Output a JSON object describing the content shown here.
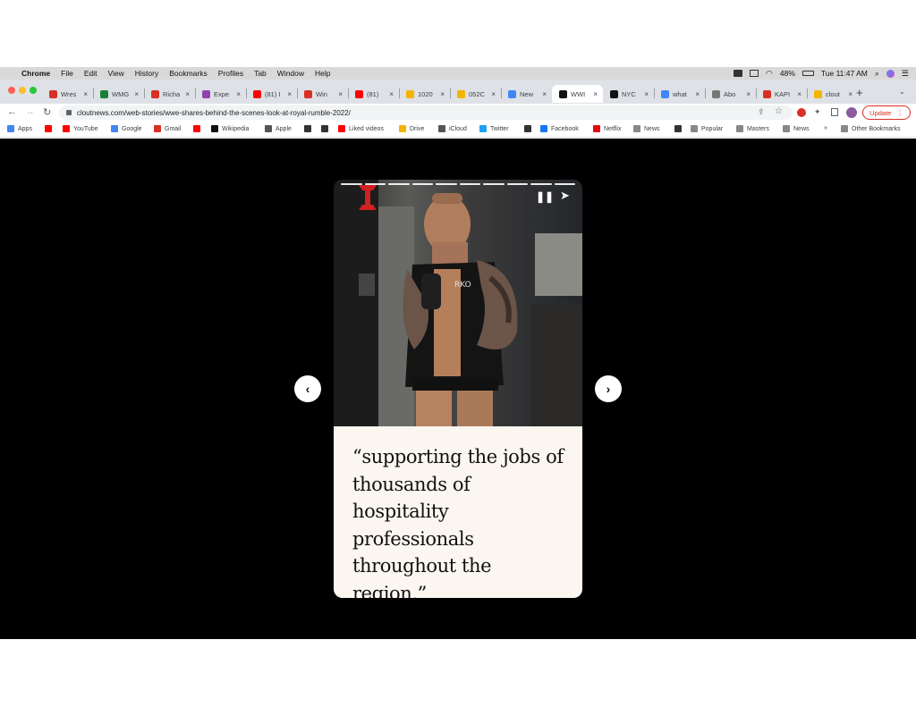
{
  "menubar": {
    "app": "Chrome",
    "items": [
      "File",
      "Edit",
      "View",
      "History",
      "Bookmarks",
      "Profiles",
      "Tab",
      "Window",
      "Help"
    ],
    "battery": "48%",
    "clock": "Tue 11:47 AM"
  },
  "tabs": [
    {
      "label": "Wres",
      "color": "#d93025"
    },
    {
      "label": "WMG",
      "color": "#188038"
    },
    {
      "label": "Richa",
      "color": "#d93025"
    },
    {
      "label": "Expe",
      "color": "#8e44ad"
    },
    {
      "label": "(81) I",
      "color": "#ff0000"
    },
    {
      "label": "Win",
      "color": "#d93025"
    },
    {
      "label": "(81)",
      "color": "#ff0000"
    },
    {
      "label": "1020",
      "color": "#f4b400"
    },
    {
      "label": "052C",
      "color": "#f4b400"
    },
    {
      "label": "New",
      "color": "#4285f4"
    },
    {
      "label": "WWI",
      "color": "#111111"
    },
    {
      "label": "NYC",
      "color": "#111111"
    },
    {
      "label": "what",
      "color": "#4285f4"
    },
    {
      "label": "Abo",
      "color": "#777777"
    },
    {
      "label": "KAPI",
      "color": "#d93025"
    },
    {
      "label": "clout",
      "color": "#f4b400"
    }
  ],
  "address": {
    "url": "cloutnews.com/web-stories/wwe-shares-behind-the-scenes-look-at-royal-rumble-2022/",
    "update_label": "Update"
  },
  "bookmarks": [
    {
      "label": "Apps",
      "color": "#4285f4"
    },
    {
      "label": "",
      "color": "#ff0000"
    },
    {
      "label": "YouTube",
      "color": "#ff0000"
    },
    {
      "label": "Google",
      "color": "#4285f4"
    },
    {
      "label": "Gmail",
      "color": "#d93025"
    },
    {
      "label": "",
      "color": "#ff0000"
    },
    {
      "label": "Wikipedia",
      "color": "#111111"
    },
    {
      "label": "Apple",
      "color": "#555555"
    },
    {
      "label": "",
      "color": "#333333"
    },
    {
      "label": "",
      "color": "#333333"
    },
    {
      "label": "Liked videos",
      "color": "#ff0000"
    },
    {
      "label": "Drive",
      "color": "#f4b400"
    },
    {
      "label": "iCloud",
      "color": "#555555"
    },
    {
      "label": "Twitter",
      "color": "#1da1f2"
    },
    {
      "label": "",
      "color": "#333333"
    },
    {
      "label": "Facebook",
      "color": "#1877f2"
    },
    {
      "label": "Netflix",
      "color": "#e50914"
    },
    {
      "label": "News",
      "color": "#888888"
    },
    {
      "label": "",
      "color": "#333333"
    },
    {
      "label": "Popular",
      "color": "#888888"
    },
    {
      "label": "Masters",
      "color": "#888888"
    },
    {
      "label": "News",
      "color": "#888888"
    },
    {
      "label": "»",
      "color": "#ffffff"
    },
    {
      "label": "Other Bookmarks",
      "color": "#888888"
    }
  ],
  "story": {
    "caption": "“supporting the jobs of thousands of hospitality professionals throughout the region.”",
    "shirt_text": "RKO",
    "progress_segments": 10
  },
  "colors": {
    "update_red": "#d93025",
    "caption_bg": "#fbf7f0",
    "page_bg": "#000000"
  }
}
